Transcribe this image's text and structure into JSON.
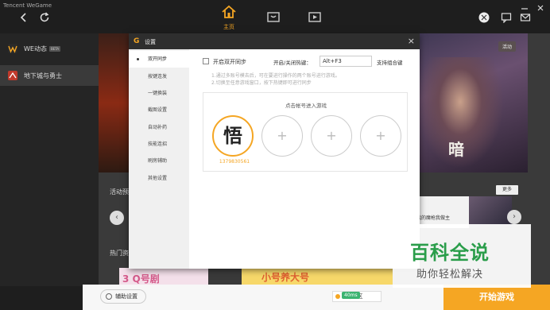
{
  "app": {
    "brand": "Tencent WeGame"
  },
  "topbar": {
    "home_label": "主页"
  },
  "sidebar": {
    "items": [
      {
        "label": "WE动态",
        "badge": "BETA"
      },
      {
        "label": "地下城与勇士"
      }
    ]
  },
  "background": {
    "start_badge": "活动",
    "big_title": "暗",
    "activity_label": "活动预",
    "more_button": "更多",
    "news_text": "我的魔枪我做主",
    "hot_label": "热门资",
    "thumb1_text": "3 Q号剧",
    "thumb2_text": "小号养大号"
  },
  "dialog": {
    "title": "设置",
    "nav": [
      {
        "label": "双开同步",
        "active": true
      },
      {
        "label": "按键连发"
      },
      {
        "label": "一键换装"
      },
      {
        "label": "截图设置"
      },
      {
        "label": "自动补药"
      },
      {
        "label": "技能连招"
      },
      {
        "label": "刷房辅助"
      },
      {
        "label": "其他设置"
      }
    ],
    "sync_checkbox": "开启双开同步",
    "hotkey_label": "开启/关闭热键：",
    "hotkey_value": "Alt+F3",
    "combo_label": "支持组合键",
    "note1": "1.通过多账号模去后，可在要进行操作的两个账号进行游戏。",
    "note2": "2.切换至任意游戏窗口，按下热键即可进行同步",
    "accounts_title": "点击帐号进入游戏",
    "account_glyph": "悟",
    "account_id": "1379830561"
  },
  "bottom": {
    "assist_label": "辅助设置",
    "server": "东北2区",
    "ping": "40ms",
    "start_button": "开始游戏"
  },
  "watermark": {
    "logo": "百科全说",
    "sub": "助你轻松解决"
  },
  "colors": {
    "accent": "#f5a623",
    "watermark_green": "#2a9d4a"
  }
}
